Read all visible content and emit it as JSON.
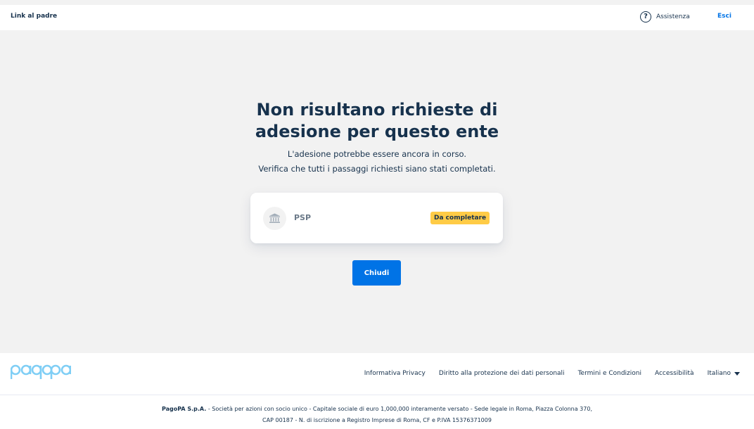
{
  "header": {
    "parent_link": "Link al padre",
    "help_icon": "question-circle-icon",
    "help_label": "Assistenza",
    "logout_label": "Esci"
  },
  "main": {
    "title_line1": "Non risultano richieste di",
    "title_line2": "adesione per questo ente",
    "subtitle_line1": "L'adesione potrebbe essere ancora in corso.",
    "subtitle_line2": "Verifica che tutti i passaggi richiesti siano stati completati.",
    "card": {
      "icon": "institution-icon",
      "name": "PSP",
      "status": "Da completare"
    },
    "close_label": "Chiudi"
  },
  "footer": {
    "logo": "pagopa",
    "links": [
      "Informativa Privacy",
      "Diritto alla protezione dei dati personali",
      "Termini e Condizioni",
      "Accessibilità"
    ],
    "language": "Italiano",
    "legal_company": "PagoPA S.p.A.",
    "legal_line1": " - Società per azioni con socio unico - Capitale sociale di euro 1,000,000 interamente versato - Sede legale in Roma, Piazza Colonna 370,",
    "legal_line2": "CAP 00187 - N. di iscrizione a Registro Imprese di Roma, CF e P.IVA 15376371009"
  },
  "colors": {
    "primary": "#0073e6",
    "text": "#17324d",
    "badge": "#ffcb46",
    "background": "#f2f2f2"
  }
}
